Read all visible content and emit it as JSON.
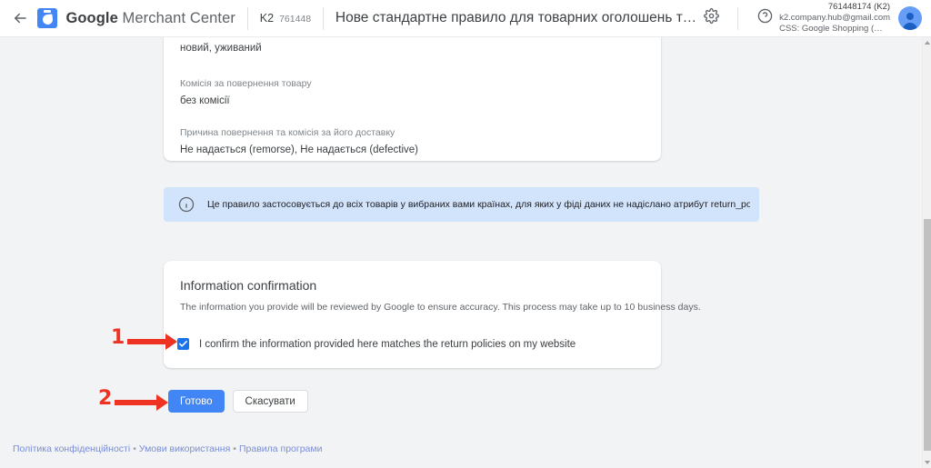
{
  "appbar": {
    "back_icon": "arrow-left-icon",
    "brand_bold": "Google",
    "brand_light": " Merchant Center",
    "account_name": "K2",
    "account_id": "761448",
    "page_title": "Нове стандартне правило для товарних оголошень та інформації …",
    "settings_icon": "gear-icon",
    "help_icon": "help-circle-icon",
    "user_line1": "761448174 (K2)",
    "user_line2": "k2.company.hub@gmail.com",
    "user_line3": "CSS: Google Shopping (googl…",
    "avatar_icon": "avatar-icon"
  },
  "top_card": {
    "fields": [
      {
        "label": "",
        "value": "новий, уживаний",
        "top_label": -1,
        "top_value": 5
      },
      {
        "label": "Комісія за повернення товару",
        "value": "без комісії",
        "top_label": 40,
        "top_value": 58
      },
      {
        "label": "Причина повернення та комісія за його доставку",
        "value": "Не надається (remorse), Не надається (defective)",
        "top_label": 94,
        "top_value": 112
      }
    ]
  },
  "banner": {
    "icon": "info-circle-icon",
    "text": "Це правило застосовується до всіх товарів у вибраних вами країнах, для яких у фіді даних не надіслано атрибут return_policy_label [мітка_правил_повернення].",
    "bg_color": "#d2e3fc"
  },
  "confirmation_card": {
    "title": "Information confirmation",
    "subtitle": "The information you provide will be reviewed by Google to ensure accuracy. This process may take up to 10 business days.",
    "checkbox_checked": true,
    "checkbox_label": "I confirm the information provided here matches the return policies on my website",
    "checkbox_color": "#1a73e8"
  },
  "actions": {
    "primary_label": "Готово",
    "secondary_label": "Скасувати",
    "primary_color": "#4285f4"
  },
  "annotations": {
    "accent_color": "#ee3322",
    "step1": "1",
    "step2": "2"
  },
  "footer": {
    "link1": "Політика конфіденційності",
    "sep1": "•",
    "link2": "Умови використання",
    "sep2": "•",
    "link3": "Правила програми"
  }
}
